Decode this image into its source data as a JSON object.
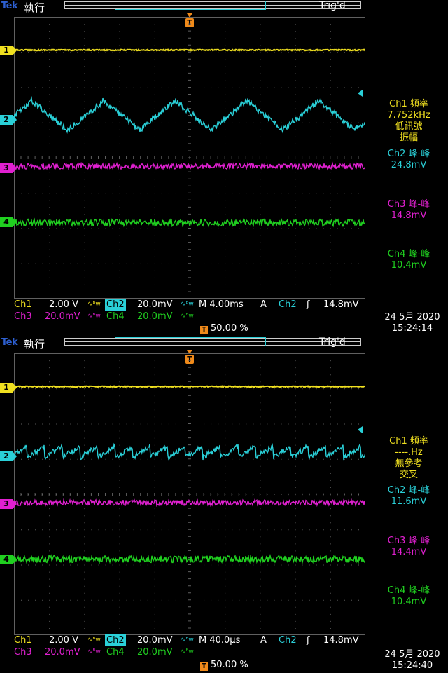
{
  "screens": [
    {
      "brand": "Tek",
      "mode": "執行",
      "trig_state": "Trig'd",
      "trigger_marker": "T",
      "channel_markers": [
        "1",
        "2",
        "3",
        "4"
      ],
      "measurements": {
        "ch1": {
          "title": "Ch1 頻率",
          "value": "7.752kHz",
          "note1": "低訊號",
          "note2": "振幅"
        },
        "ch2": {
          "title": "Ch2 峰-峰",
          "value": "24.8mV"
        },
        "ch3": {
          "title": "Ch3 峰-峰",
          "value": "14.8mV"
        },
        "ch4": {
          "title": "Ch4 峰-峰",
          "value": "10.4mV"
        }
      },
      "status": {
        "ch1_label": "Ch1",
        "ch1_scale": "2.00 V",
        "ch2_label": "Ch2",
        "ch2_scale": "20.0mV",
        "ch3_label": "Ch3",
        "ch3_scale": "20.0mV",
        "ch4_label": "Ch4",
        "ch4_scale": "20.0mV",
        "coupling": "∿ᴮw",
        "timebase": "M 4.00ms",
        "trig_mode": "A",
        "trig_source": "Ch2",
        "trig_slope": "ʃ",
        "trig_level": "14.8mV",
        "trig_position": "50.00 %"
      },
      "date": "24 5月  2020",
      "time": "15:24:14",
      "ch2_wave": {
        "type": "triangle",
        "cycles": 4.9,
        "amplitude": 0.22
      }
    },
    {
      "brand": "Tek",
      "mode": "執行",
      "trig_state": "Trig'd",
      "trigger_marker": "T",
      "channel_markers": [
        "1",
        "2",
        "3",
        "4"
      ],
      "measurements": {
        "ch1": {
          "title": "Ch1 頻率",
          "value": "----.Hz",
          "note1": "無參考",
          "note2": "交叉"
        },
        "ch2": {
          "title": "Ch2 峰-峰",
          "value": "11.6mV"
        },
        "ch3": {
          "title": "Ch3 峰-峰",
          "value": "14.4mV"
        },
        "ch4": {
          "title": "Ch4 峰-峰",
          "value": "10.4mV"
        }
      },
      "status": {
        "ch1_label": "Ch1",
        "ch1_scale": "2.00 V",
        "ch2_label": "Ch2",
        "ch2_scale": "20.0mV",
        "ch3_label": "Ch3",
        "ch3_scale": "20.0mV",
        "ch4_label": "Ch4",
        "ch4_scale": "20.0mV",
        "coupling": "∿ᴮw",
        "timebase": "M 40.0µs",
        "trig_mode": "A",
        "trig_source": "Ch2",
        "trig_slope": "ʃ",
        "trig_level": "14.8mV",
        "trig_position": "50.00 %"
      },
      "date": "24 5月  2020",
      "time": "15:24:40",
      "ch2_wave": {
        "type": "sawtooth",
        "cycles": 20,
        "amplitude": 0.08
      }
    }
  ],
  "colors": {
    "ch1": "#f0e020",
    "ch2": "#2ad0d8",
    "ch3": "#e020d0",
    "ch4": "#20d020",
    "trigger": "#f08a1a",
    "graticule": "#606060"
  }
}
